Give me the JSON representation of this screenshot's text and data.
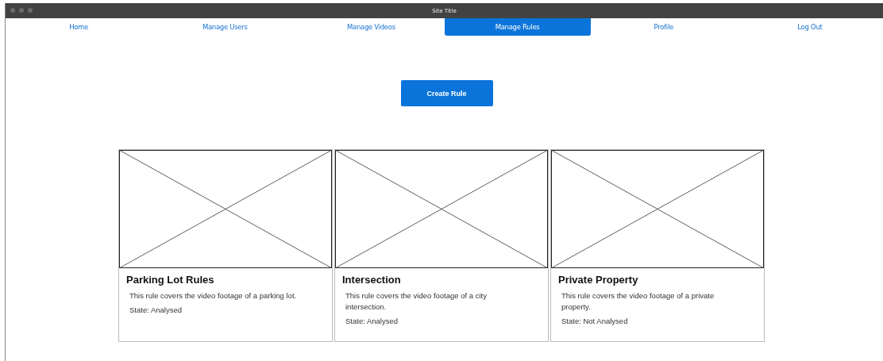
{
  "window": {
    "title": "Site Title"
  },
  "nav": [
    {
      "label": "Home",
      "selected": false
    },
    {
      "label": "Manage Users",
      "selected": false
    },
    {
      "label": "Manage Videos",
      "selected": false
    },
    {
      "label": "Manage Rules",
      "selected": true
    },
    {
      "label": "Profile",
      "selected": false
    },
    {
      "label": "Log Out",
      "selected": false
    }
  ],
  "create_button": "Create Rule",
  "rules": [
    {
      "title": "Parking Lot Rules",
      "description": "This rule covers the video footage of a parking lot.",
      "state": "State: Analysed"
    },
    {
      "title": "Intersection",
      "description": "This rule covers the video footage of a city intersection.",
      "state": "State: Analysed"
    },
    {
      "title": "Private Property",
      "description": "This rule covers the video footage of a private property.",
      "state": "State: Not Analysed"
    }
  ]
}
